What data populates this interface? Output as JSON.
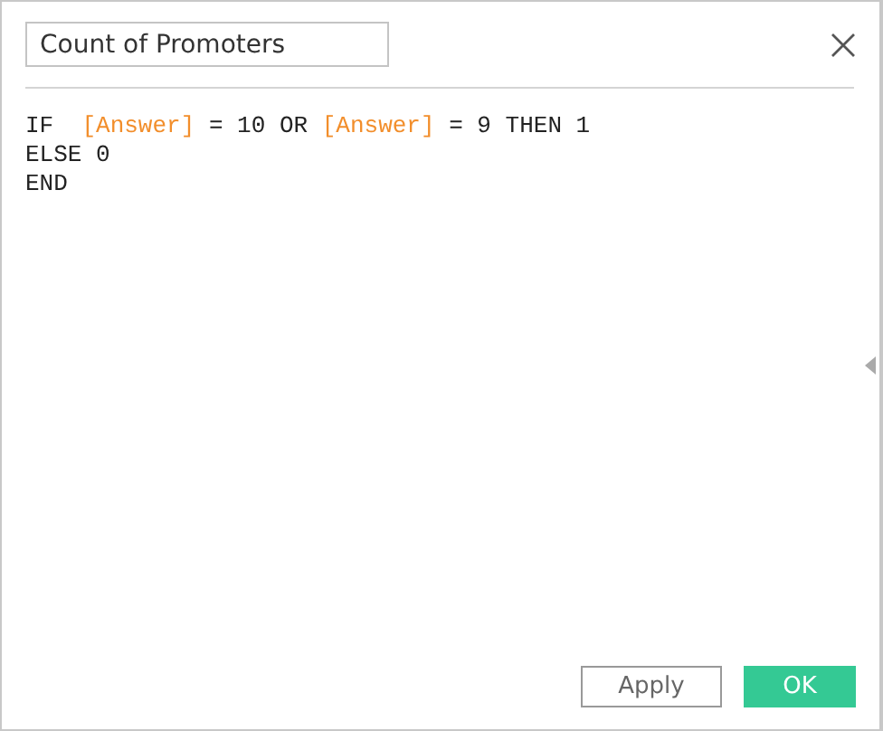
{
  "title_field": {
    "value": "Count of Promoters"
  },
  "formula_lines": [
    [
      {
        "kind": "keyword",
        "text": "IF  "
      },
      {
        "kind": "field",
        "text": "[Answer]"
      },
      {
        "kind": "keyword",
        "text": " = 10 OR "
      },
      {
        "kind": "field",
        "text": "[Answer]"
      },
      {
        "kind": "keyword",
        "text": " = 9 THEN 1"
      }
    ],
    [
      {
        "kind": "keyword",
        "text": "ELSE 0"
      }
    ],
    [
      {
        "kind": "keyword",
        "text": "END"
      }
    ]
  ],
  "buttons": [
    {
      "label": "Apply",
      "kind": "secondary"
    },
    {
      "label": "OK",
      "kind": "primary"
    }
  ]
}
